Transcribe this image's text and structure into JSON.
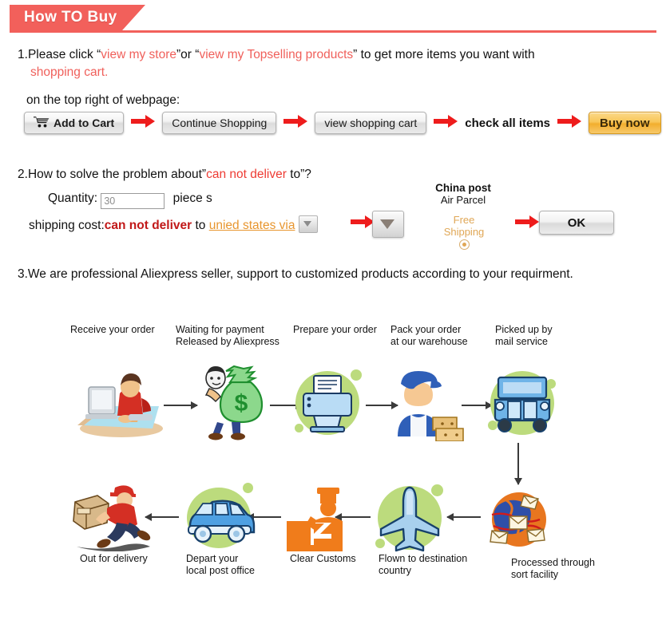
{
  "banner": {
    "title": "How TO Buy"
  },
  "step1": {
    "number": "1.",
    "lead": "Please click ",
    "q_open": "“",
    "link1": "view my store",
    "q_close_or": "”or “",
    "link2": "view my Topselling products",
    "tail": "” to get more items you want with",
    "line2_red": "shopping cart.",
    "line3": "on the top right of webpage:"
  },
  "buttons": {
    "add_to_cart": "Add to Cart",
    "cart_icon": "shopping-cart-icon",
    "continue_shopping": "Continue Shopping",
    "view_shopping_cart": "view shopping cart",
    "check_all_items": "check all items",
    "buy_now": "Buy now",
    "arrow_icon": "red-right-arrow-icon"
  },
  "step2": {
    "number": "2.",
    "line1_a": "How to solve the problem about”",
    "line1_red": "can not deliver",
    "line1_b": " to”?",
    "quantity_label": "Quantity:",
    "quantity_value": "30",
    "quantity_unit": "piece s",
    "shipping_label": "shipping cost:",
    "shipping_red": "can not deliver",
    "shipping_to": " to ",
    "shipping_link": "unied states via",
    "china_post_title": "China post",
    "china_post_sub": "Air Parcel",
    "free_shipping_l1": "Free",
    "free_shipping_l2": "Shipping",
    "ok_label": "OK"
  },
  "step3": {
    "text": "3.We are professional Aliexpress seller, support to customized products according to your requirment."
  },
  "flow": {
    "top_labels": [
      {
        "l1": "Receive your order",
        "l2": ""
      },
      {
        "l1": "Waiting for payment",
        "l2": "Released by Aliexpress"
      },
      {
        "l1": "Prepare your order",
        "l2": ""
      },
      {
        "l1": "Pack your order",
        "l2": "at our warehouse"
      },
      {
        "l1": "Picked up by",
        "l2": "mail service"
      }
    ],
    "bottom_labels": [
      {
        "l1": "Out for delivery",
        "l2": ""
      },
      {
        "l1": "Depart your",
        "l2": "local post office"
      },
      {
        "l1": "Clear Customs",
        "l2": ""
      },
      {
        "l1": "Flown to destination",
        "l2": "country"
      },
      {
        "l1": "Processed through",
        "l2": "sort facility"
      }
    ],
    "icons": [
      "person-at-computer-icon",
      "money-bag-icon",
      "printer-icon",
      "warehouse-worker-packing-icon",
      "delivery-truck-icon",
      "mail-sorting-globe-icon",
      "airplane-icon",
      "customs-officer-icon",
      "blue-van-icon",
      "running-delivery-man-icon"
    ]
  },
  "colors": {
    "brand_red": "#f2605b",
    "link_red": "#f0605b",
    "dark_red": "#c11818",
    "orange_link": "#e8962f",
    "free_shipping": "#e0a756",
    "blob_green": "#bcdb7d",
    "buy_now_gold": "#f2ae2e"
  }
}
